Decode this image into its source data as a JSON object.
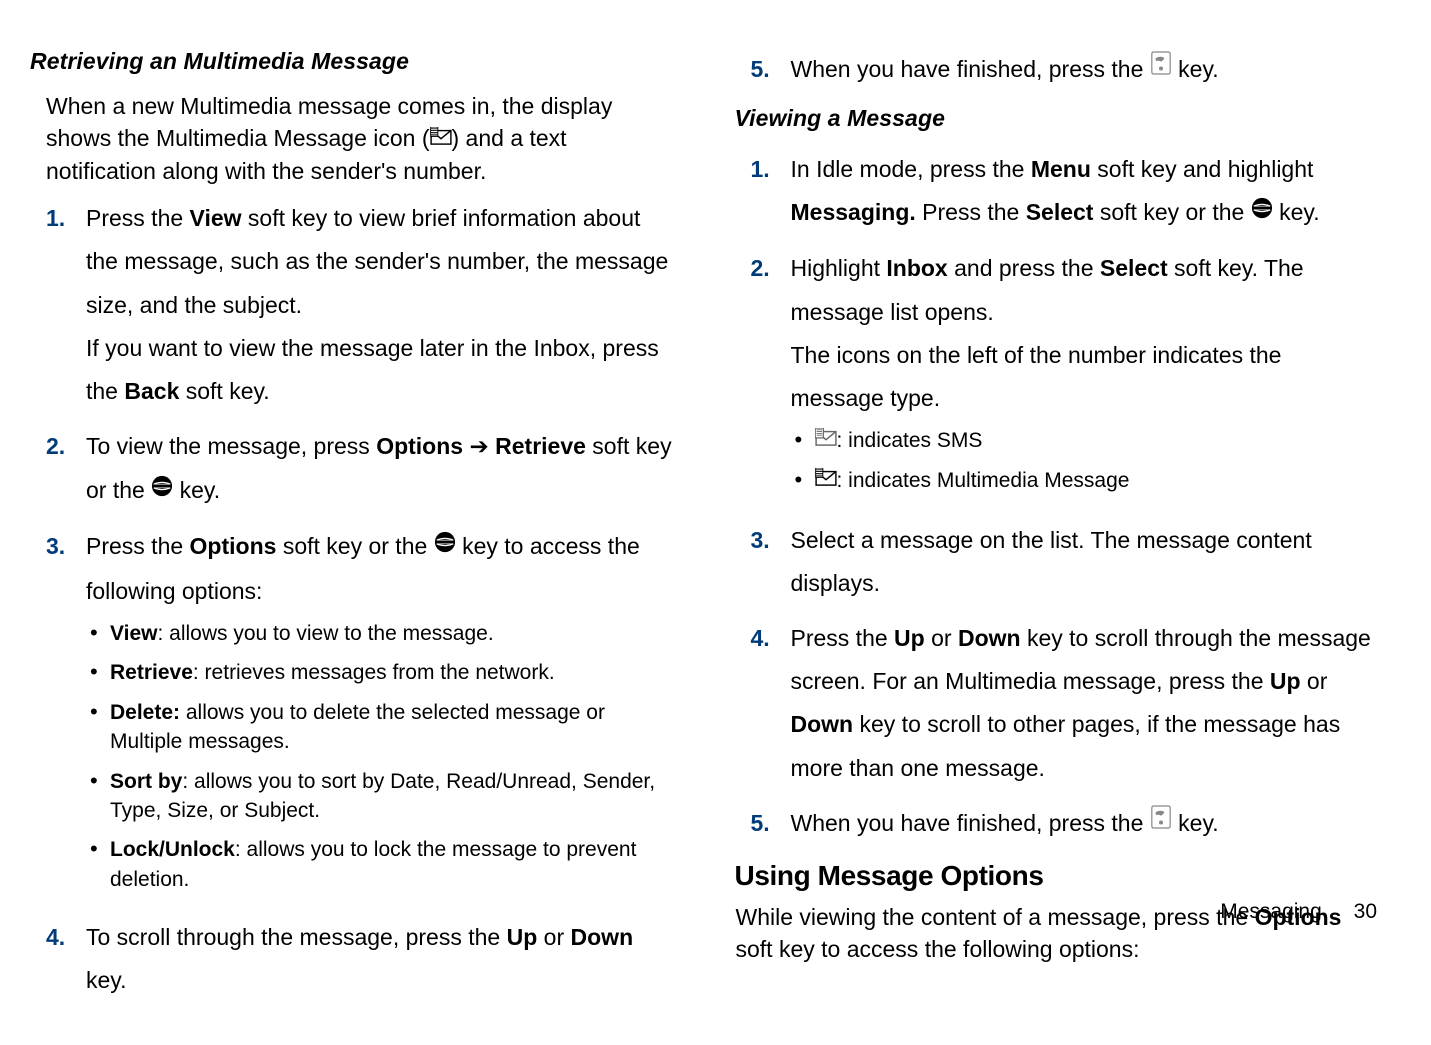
{
  "left": {
    "heading": "Retrieving an Multimedia Message",
    "intro_a": "When a new Multimedia message comes in, the display shows the Multimedia Message icon (",
    "intro_b": ") and a text notification along with the sender's number.",
    "steps": {
      "n1": "1.",
      "s1a": "Press the ",
      "s1b": "View",
      "s1c": " soft key to view brief information about the message, such as the sender's number, the message size, and the subject.",
      "s1d": "If you want to view the message later in the Inbox, press the ",
      "s1e": "Back",
      "s1f": " soft key.",
      "n2": "2.",
      "s2a": "To view the message, press ",
      "s2b": "Options",
      "s2arrow": " ➔ ",
      "s2c": "Retrieve",
      "s2d": " soft key or the ",
      "s2e": " key.",
      "n3": "3.",
      "s3a": "Press the ",
      "s3b": "Options",
      "s3c": " soft key or the ",
      "s3d": " key to access the following options:",
      "bullets": {
        "b1a": "View",
        "b1b": ": allows you to view to the message.",
        "b2a": "Retrieve",
        "b2b": ": retrieves messages from the network.",
        "b3a": "Delete:",
        "b3b": " allows you to delete the selected message or Multiple messages.",
        "b4a": "Sort by",
        "b4b": ": allows you to sort by Date, Read/Unread, Sender, Type, Size, or Subject.",
        "b5a": "Lock/Unlock",
        "b5b": ": allows you to lock the message to prevent deletion."
      },
      "n4": "4.",
      "s4a": "To scroll through the message, press the ",
      "s4b": "Up",
      "s4c": " or ",
      "s4d": "Down",
      "s4e": " key."
    }
  },
  "right": {
    "n5": "5.",
    "s5a": "When you have finished, press the ",
    "s5b": " key.",
    "heading": "Viewing a Message",
    "steps": {
      "n1": "1.",
      "s1a": "In Idle mode, press the ",
      "s1b": "Menu",
      "s1c": " soft key and highlight ",
      "s1d": "Messaging.",
      "s1e": " Press the ",
      "s1f": "Select",
      "s1g": " soft key or the ",
      "s1h": " key.",
      "n2": "2.",
      "s2a": "Highlight ",
      "s2b": "Inbox",
      "s2c": " and press the ",
      "s2d": "Select",
      "s2e": " soft key. The message list opens.",
      "s2f": "The icons on the left of the number indicates the message type.",
      "bullets": {
        "b1": ": indicates SMS",
        "b2": ": indicates Multimedia Message"
      },
      "n3": "3.",
      "s3": "Select a message on the list. The message content displays.",
      "n4": "4.",
      "s4a": "Press the ",
      "s4b": "Up",
      "s4c": " or ",
      "s4d": "Down",
      "s4e": " key to scroll through the message screen. For an Multimedia message, press the ",
      "s4f": "Up",
      "s4g": " or ",
      "s4h": "Down",
      "s4i": " key to scroll to other pages, if the message has more than one message.",
      "n5": "5.",
      "s5a": "When you have finished, press the ",
      "s5b": " key."
    },
    "section": "Using Message Options",
    "sectionPara_a": "While viewing the content of a message, press the ",
    "sectionPara_b": "Options",
    "sectionPara_c": " soft key to access the following options:"
  },
  "footer": {
    "section": "Messaging",
    "page": "30"
  }
}
